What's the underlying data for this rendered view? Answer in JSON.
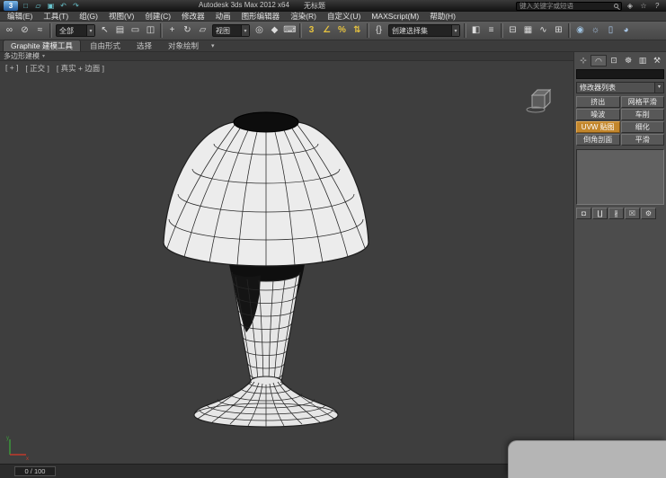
{
  "title_bar": {
    "app_title": "Autodesk 3ds Max 2012 x64",
    "doc_title": "无标题",
    "search_placeholder": "键入关键字或短语"
  },
  "menu": {
    "items": [
      "编辑(E)",
      "工具(T)",
      "组(G)",
      "视图(V)",
      "创建(C)",
      "修改器",
      "动画",
      "图形编辑器",
      "渲染(R)",
      "自定义(U)",
      "MAXScript(M)",
      "帮助(H)"
    ]
  },
  "toolbar": {
    "selection_filter": "全部",
    "reference_coordsys": "视图",
    "named_selection": "创建选择集"
  },
  "ribbon": {
    "tabs": [
      "Graphite 建模工具",
      "自由形式",
      "选择",
      "对象绘制"
    ],
    "panel_title": "多边形建模"
  },
  "viewport": {
    "label_plus": "[ + ]",
    "label_view": "[ 正交 ]",
    "label_shading": "[ 真实 + 边面 ]"
  },
  "command_panel": {
    "modifier_list": "修改器列表",
    "modifier_buttons": [
      "挤出",
      "网格平滑",
      "噪波",
      "车削",
      "UVW 贴图",
      "细化",
      "倒角剖面",
      "平滑"
    ]
  },
  "timeline": {
    "frame_label": "0 / 100"
  },
  "colors": {
    "modifier_highlight": "#c2862c",
    "viewport_bg": "#3e3e3e"
  },
  "icons": {
    "app_logo": "3",
    "new_file": "□",
    "open_file": "▱",
    "save_file": "▣",
    "undo": "↶",
    "redo": "↷",
    "comm_center": "◈",
    "favorites": "☆",
    "help": "?",
    "select_link": "∞",
    "unlink": "⊘",
    "bind_spacewarp": "≈",
    "select_object": "↖",
    "select_by_name": "▤",
    "region_shape": "▭",
    "window_crossing": "◫",
    "move": "+",
    "rotate": "↻",
    "scale": "▱",
    "pivot_center": "◎",
    "manipulate": "◆",
    "kbd_override": "⌨",
    "snap_3d": "3",
    "angle_snap": "∠",
    "percent_snap": "%",
    "spinner_snap": "⇅",
    "named_sets": "{}",
    "mirror": "◧",
    "align": "≡",
    "layer_manager": "⊟",
    "ribbon_toggle": "▦",
    "curve_editor": "∿",
    "schematic_view": "⊞",
    "material_editor": "◉",
    "render_setup": "☼",
    "rendered_frame": "▯",
    "render_production": "◕",
    "tab_create": "⊹",
    "tab_modify": "◠",
    "tab_hierarchy": "⊡",
    "tab_motion": "☸",
    "tab_display": "▥",
    "tab_utilities": "⚒",
    "pin_stack": "◘",
    "show_end_result": "∐",
    "make_unique": "∦",
    "remove_modifier": "☒",
    "configure_sets": "⚙",
    "dropdown_arrow": "▾"
  }
}
